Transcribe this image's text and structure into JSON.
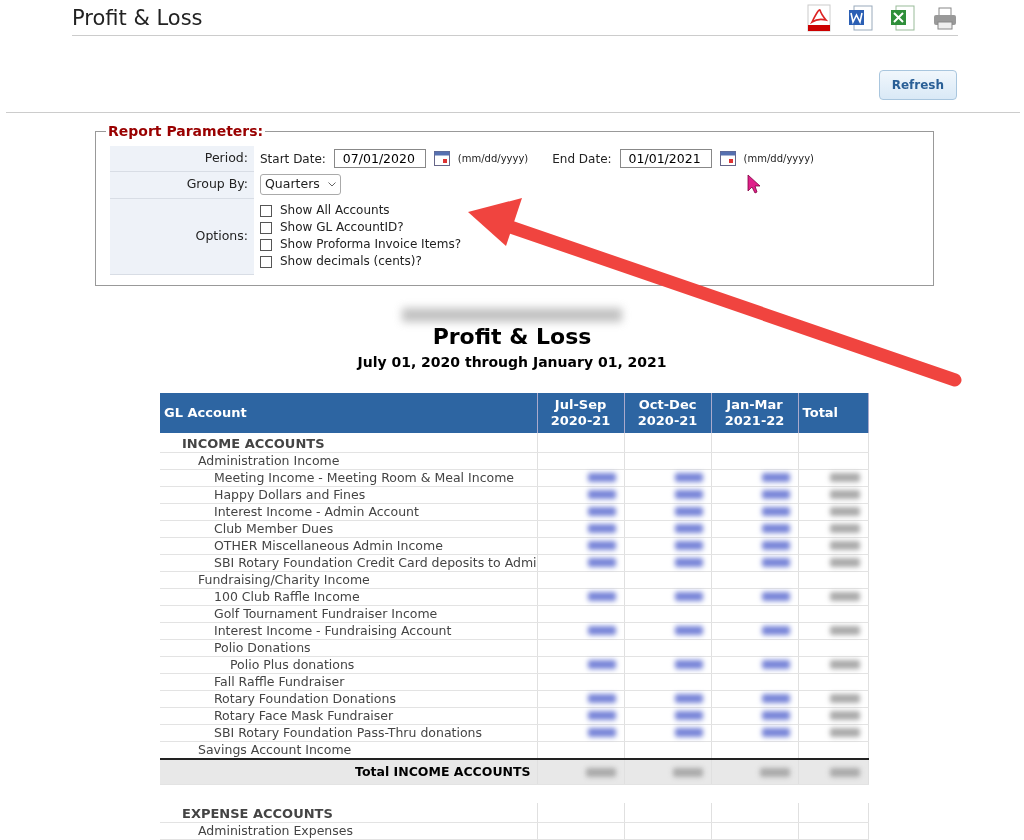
{
  "page_title": "Profit & Loss",
  "toolbar": {
    "refresh": "Refresh"
  },
  "parameters": {
    "legend": "Report Parameters:",
    "period": {
      "label": "Period:",
      "start_label": "Start Date:",
      "start_value": "07/01/2020",
      "start_hint": "(mm/dd/yyyy)",
      "end_label": "End Date:",
      "end_value": "01/01/2021",
      "end_hint": "(mm/dd/yyyy)"
    },
    "group_by": {
      "label": "Group By:",
      "value": "Quarters"
    },
    "options": {
      "label": "Options:",
      "items": [
        {
          "label": "Show All Accounts",
          "checked": false
        },
        {
          "label": "Show GL AccountID?",
          "checked": false
        },
        {
          "label": "Show Proforma Invoice Items?",
          "checked": false
        },
        {
          "label": "Show decimals (cents)?",
          "checked": false
        }
      ]
    }
  },
  "report": {
    "title": "Profit & Loss",
    "subtitle": "July 01, 2020 through January 01, 2021",
    "table": {
      "columns": [
        {
          "label": "GL Account"
        },
        {
          "label": "Jul-Sep 2020-21"
        },
        {
          "label": "Oct-Dec 2020-21"
        },
        {
          "label": "Jan-Mar 2021-22"
        },
        {
          "label": "Total"
        }
      ],
      "rows": [
        {
          "kind": "section",
          "label": "INCOME ACCOUNTS",
          "children": [
            {
              "kind": "group",
              "label": "Administration Income",
              "children": [
                {
                  "kind": "amounts",
                  "label": "Meeting Income - Meeting Room & Meal Income"
                },
                {
                  "kind": "amounts",
                  "label": "Happy Dollars and Fines"
                },
                {
                  "kind": "amounts",
                  "label": "Interest Income - Admin Account"
                },
                {
                  "kind": "amounts",
                  "label": "Club Member Dues"
                },
                {
                  "kind": "amounts",
                  "label": "OTHER Miscellaneous Admin Income"
                },
                {
                  "kind": "amounts",
                  "label": "SBI Rotary Foundation Credit Card deposits to Admi"
                }
              ]
            },
            {
              "kind": "group",
              "label": "Fundraising/Charity Income",
              "children": [
                {
                  "kind": "amounts",
                  "label": "100 Club Raffle Income"
                },
                {
                  "kind": "group",
                  "label": "Golf Tournament Fundraiser Income"
                },
                {
                  "kind": "amounts",
                  "label": "Interest Income - Fundraising Account"
                },
                {
                  "kind": "group",
                  "label": "Polio Donations",
                  "children": [
                    {
                      "kind": "amounts",
                      "label": "Polio Plus donations"
                    }
                  ]
                },
                {
                  "kind": "group",
                  "label": "Fall Raffle Fundraiser"
                },
                {
                  "kind": "amounts",
                  "label": "Rotary Foundation Donations"
                },
                {
                  "kind": "amounts",
                  "label": "Rotary Face Mask Fundraiser"
                },
                {
                  "kind": "amounts",
                  "label": "SBI Rotary Foundation Pass-Thru donations"
                }
              ]
            },
            {
              "kind": "group",
              "label": "Savings Account Income"
            }
          ]
        },
        {
          "kind": "total",
          "label": "Total INCOME ACCOUNTS"
        },
        {
          "kind": "spacer"
        },
        {
          "kind": "section",
          "label": "EXPENSE ACCOUNTS",
          "children": [
            {
              "kind": "group",
              "label": "Administration Expenses"
            }
          ]
        }
      ]
    }
  }
}
